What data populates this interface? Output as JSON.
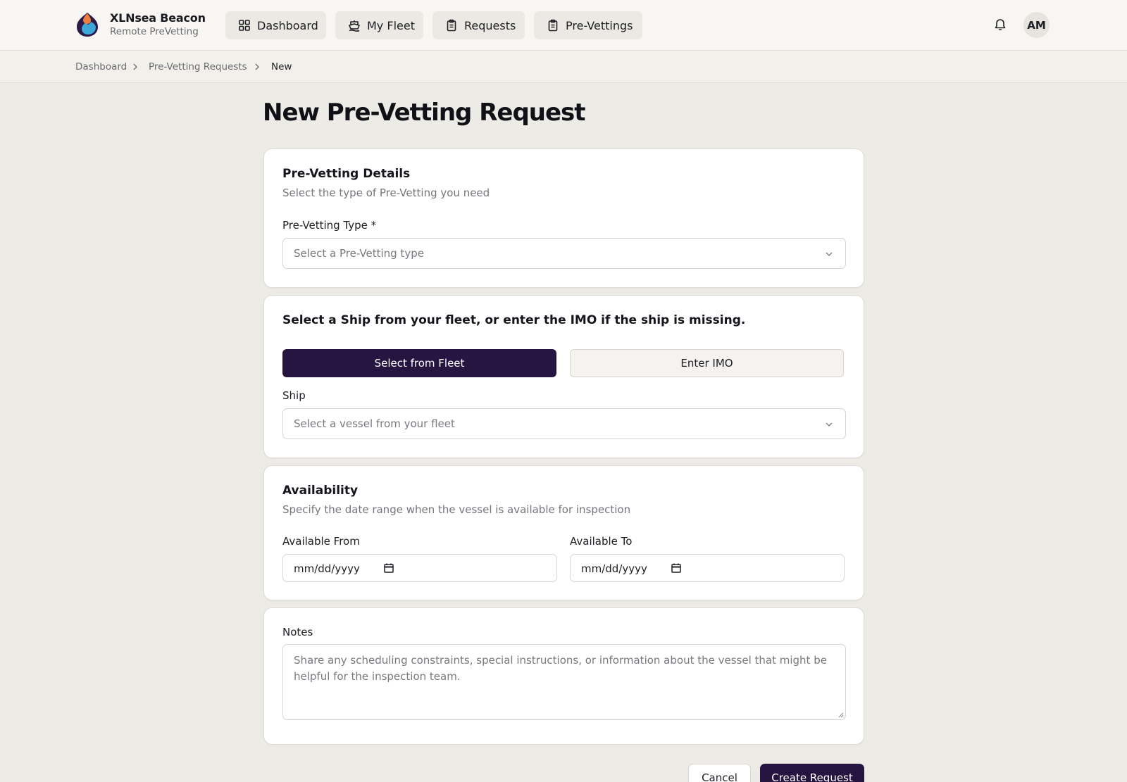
{
  "brand": {
    "title": "XLNsea Beacon",
    "subtitle": "Remote PreVetting"
  },
  "nav": [
    {
      "label": "Dashboard",
      "icon": "grid-icon"
    },
    {
      "label": "My Fleet",
      "icon": "ship-icon"
    },
    {
      "label": "Requests",
      "icon": "clipboard-icon"
    },
    {
      "label": "Pre-Vettings",
      "icon": "clipboard-check-icon"
    }
  ],
  "user": {
    "initials": "AM"
  },
  "breadcrumb": [
    "Dashboard",
    "Pre-Vetting Requests",
    "New"
  ],
  "page": {
    "title": "New Pre-Vetting Request"
  },
  "details": {
    "title": "Pre-Vetting Details",
    "description": "Select the type of Pre-Vetting you need",
    "type_label": "Pre-Vetting Type *",
    "type_placeholder": "Select a Pre-Vetting type"
  },
  "ship": {
    "title": "Select a Ship from your fleet, or enter the IMO if the ship is missing.",
    "toggle_fleet": "Select from Fleet",
    "toggle_imo": "Enter IMO",
    "ship_label": "Ship",
    "ship_placeholder": "Select a vessel from your fleet"
  },
  "availability": {
    "title": "Availability",
    "description": "Specify the date range when the vessel is available for inspection",
    "from_label": "Available From",
    "to_label": "Available To",
    "from_value": "mm/dd/yyyy",
    "to_value": "mm/dd/yyyy"
  },
  "notes": {
    "label": "Notes",
    "placeholder": "Share any scheduling constraints, special instructions, or information about the vessel that might be helpful for the inspection team."
  },
  "actions": {
    "cancel": "Cancel",
    "create": "Create Request"
  },
  "colors": {
    "primary": "#261541",
    "background": "#ecebe5",
    "card": "#ffffff"
  }
}
